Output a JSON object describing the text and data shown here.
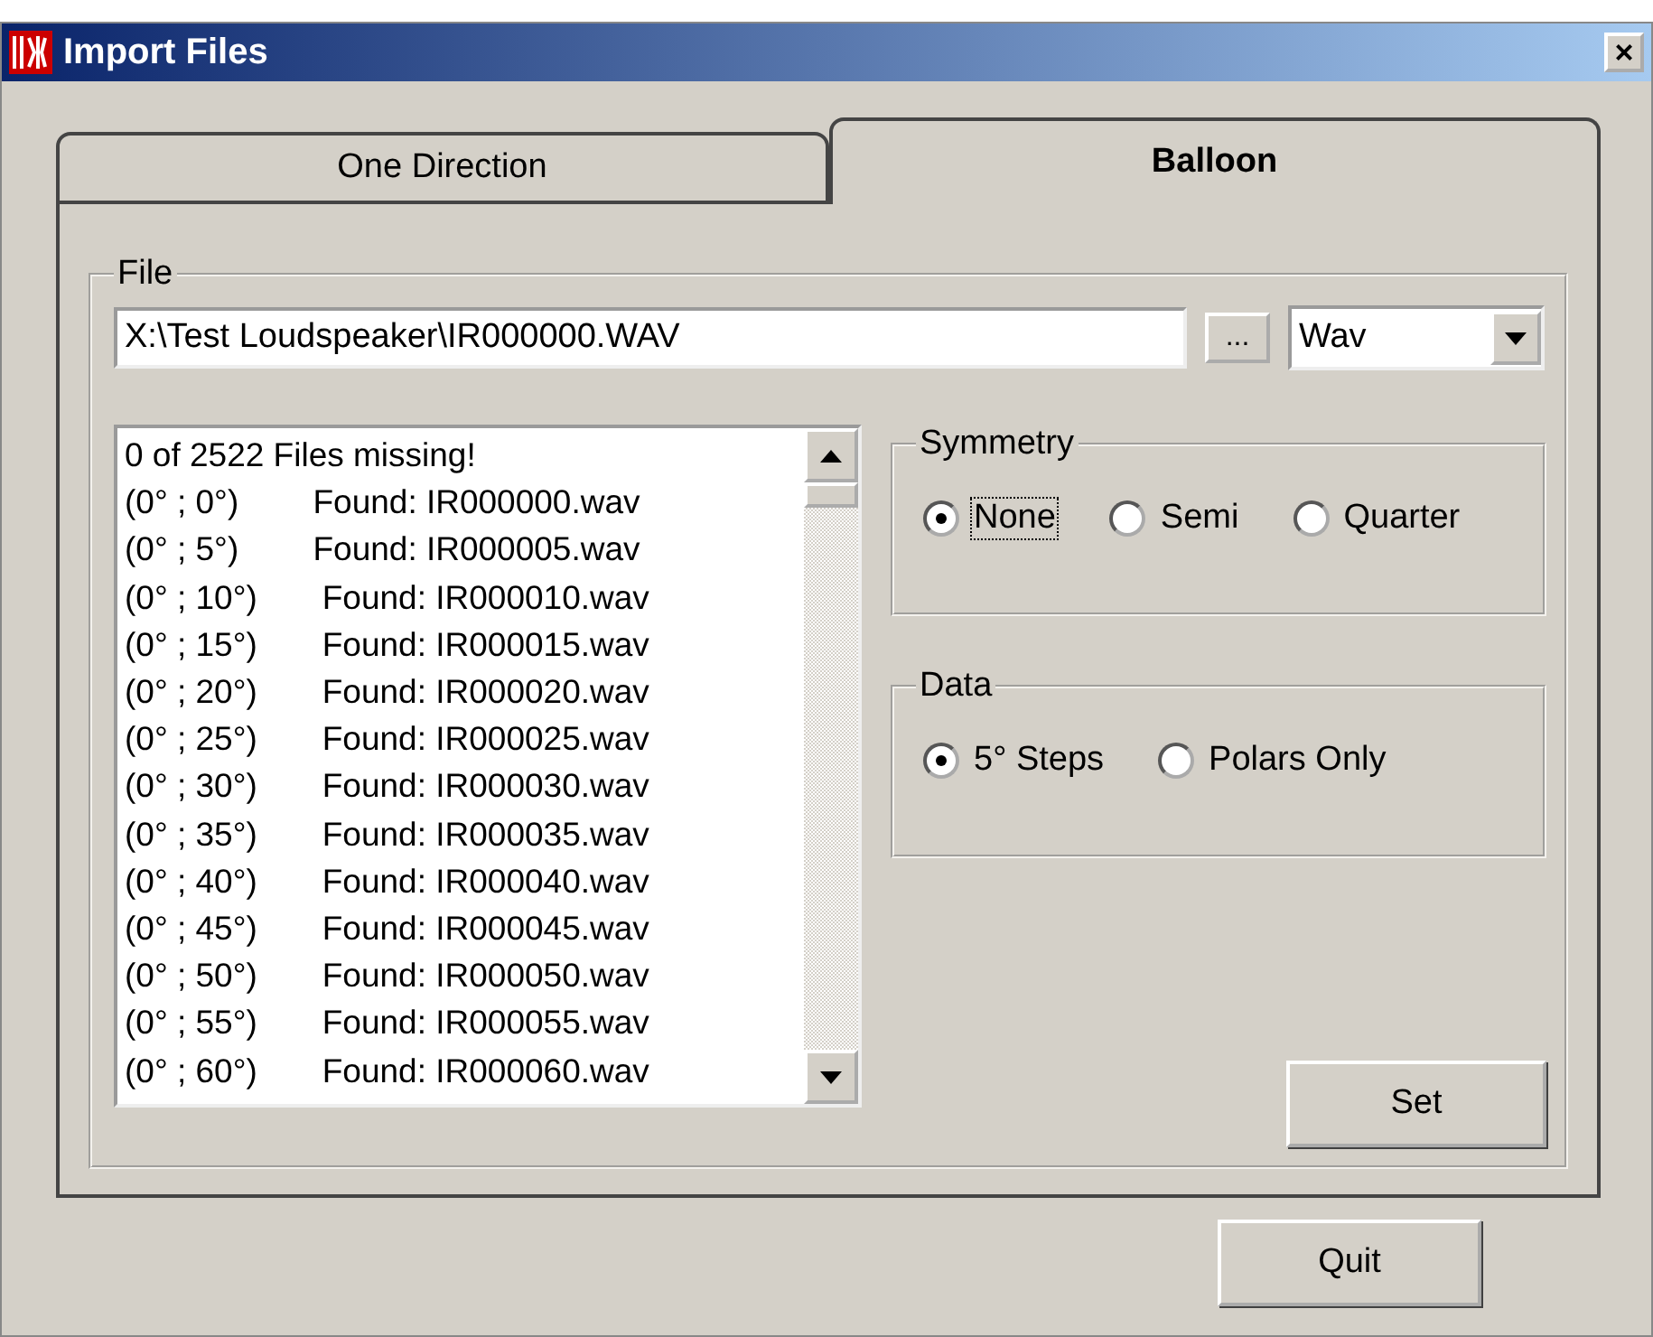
{
  "window": {
    "title": "Import Files",
    "close": "×"
  },
  "tabs": [
    {
      "label": "One Direction",
      "selected": false
    },
    {
      "label": "Balloon",
      "selected": true
    }
  ],
  "file_group": {
    "label": "File",
    "path": "X:\\Test Loudspeaker\\IR000000.WAV",
    "browse": "...",
    "format": "Wav"
  },
  "list": [
    "0 of 2522 Files missing!",
    "(0° ; 0°)        Found: IR000000.wav",
    "(0° ; 5°)        Found: IR000005.wav",
    "(0° ; 10°)       Found: IR000010.wav",
    "(0° ; 15°)       Found: IR000015.wav",
    "(0° ; 20°)       Found: IR000020.wav",
    "(0° ; 25°)       Found: IR000025.wav",
    "(0° ; 30°)       Found: IR000030.wav",
    "(0° ; 35°)       Found: IR000035.wav",
    "(0° ; 40°)       Found: IR000040.wav",
    "(0° ; 45°)       Found: IR000045.wav",
    "(0° ; 50°)       Found: IR000050.wav",
    "(0° ; 55°)       Found: IR000055.wav",
    "(0° ; 60°)       Found: IR000060.wav"
  ],
  "symmetry": {
    "label": "Symmetry",
    "options": [
      {
        "label": "None",
        "selected": true,
        "focused": true
      },
      {
        "label": "Semi",
        "selected": false,
        "focused": false
      },
      {
        "label": "Quarter",
        "selected": false,
        "focused": false
      }
    ]
  },
  "data": {
    "label": "Data",
    "options": [
      {
        "label": "5° Steps",
        "selected": true,
        "focused": false
      },
      {
        "label": "Polars Only",
        "selected": false,
        "focused": false
      }
    ]
  },
  "set_button": "Set",
  "quit_button": "Quit"
}
